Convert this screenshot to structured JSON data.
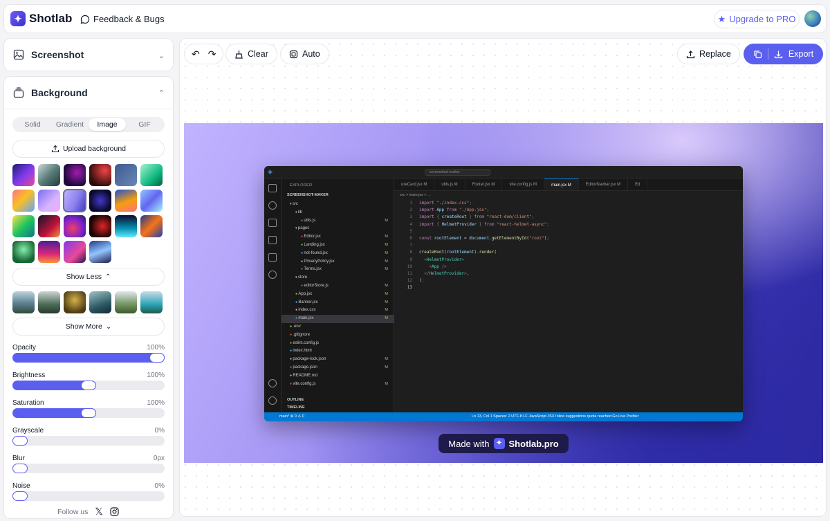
{
  "header": {
    "brand": "Shotlab",
    "feedback_label": "Feedback & Bugs",
    "upgrade_label": "Upgrade to PRO"
  },
  "sidebar": {
    "screenshot_title": "Screenshot",
    "background_title": "Background",
    "bg_tabs": [
      "Solid",
      "Gradient",
      "Image",
      "GIF"
    ],
    "bg_tab_selected": "Image",
    "upload_label": "Upload background",
    "show_less_label": "Show Less",
    "show_more_label": "Show More",
    "sliders": [
      {
        "label": "Opacity",
        "value": "100%",
        "level": 1.0
      },
      {
        "label": "Brightness",
        "value": "100%",
        "level": 0.5
      },
      {
        "label": "Saturation",
        "value": "100%",
        "level": 0.5
      },
      {
        "label": "Grayscale",
        "value": "0%",
        "level": 0.0
      },
      {
        "label": "Blur",
        "value": "0px",
        "level": 0.0
      },
      {
        "label": "Noise",
        "value": "0%",
        "level": 0.0
      }
    ],
    "follow_label": "Follow us"
  },
  "toolbar": {
    "clear_label": "Clear",
    "auto_label": "Auto",
    "replace_label": "Replace",
    "export_label": "Export"
  },
  "editor": {
    "title": "screenshot-maker",
    "explorer_label": "EXPLORER",
    "root": "SCREENSHOT-MAKER",
    "tree": [
      {
        "name": "src",
        "indent": 1,
        "icon": "▾"
      },
      {
        "name": "lib",
        "indent": 2,
        "icon": "▾"
      },
      {
        "name": "utils.js",
        "indent": 3,
        "icon": "",
        "m": true
      },
      {
        "name": "pages",
        "indent": 2,
        "icon": "▾"
      },
      {
        "name": "Editor.jsx",
        "indent": 3,
        "icon": "",
        "m": true
      },
      {
        "name": "Landing.jsx",
        "indent": 3,
        "icon": "",
        "m": true
      },
      {
        "name": "not-found.jsx",
        "indent": 3,
        "icon": "",
        "m": true
      },
      {
        "name": "PrivacyPolicy.jsx",
        "indent": 3,
        "icon": "",
        "m": true
      },
      {
        "name": "Terms.jsx",
        "indent": 3,
        "icon": "",
        "m": true
      },
      {
        "name": "store",
        "indent": 2,
        "icon": "▾"
      },
      {
        "name": "editorStore.js",
        "indent": 3,
        "icon": "",
        "m": true
      },
      {
        "name": "App.jsx",
        "indent": 2,
        "icon": "",
        "m": true
      },
      {
        "name": "Banner.jsx",
        "indent": 2,
        "icon": "",
        "m": true
      },
      {
        "name": "index.css",
        "indent": 2,
        "icon": "",
        "m": true
      },
      {
        "name": "main.jsx",
        "indent": 2,
        "icon": "",
        "m": true,
        "active": true
      },
      {
        "name": ".env",
        "indent": 1,
        "icon": ""
      },
      {
        "name": ".gitignore",
        "indent": 1,
        "icon": ""
      },
      {
        "name": "eslint.config.js",
        "indent": 1,
        "icon": ""
      },
      {
        "name": "index.html",
        "indent": 1,
        "icon": ""
      },
      {
        "name": "package-lock.json",
        "indent": 1,
        "icon": "",
        "m": true
      },
      {
        "name": "package.json",
        "indent": 1,
        "icon": "",
        "m": true
      },
      {
        "name": "README.md",
        "indent": 1,
        "icon": ""
      },
      {
        "name": "vite.config.js",
        "indent": 1,
        "icon": "",
        "m": true
      }
    ],
    "outline_label": "OUTLINE",
    "timeline_label": "TIMELINE",
    "tabs": [
      "ureCard.jsx M",
      "utils.js M",
      "Footer.jsx M",
      "vite.config.js M",
      "main.jsx M",
      "EditorNavbar.jsx M",
      "Ed"
    ],
    "active_tab": "main.jsx M",
    "breadcrumb": "src > main.jsx > ...",
    "status_left": "main*   ⊗ 0 ⚠ 0",
    "status_right": "Ln 13, Col 1   Spaces: 2   UTF-8   LF   JavaScript JSX   Inline suggestions quota reached   Go Live   Prettier"
  },
  "badge": {
    "made_with": "Made with",
    "brand": "Shotlab.pro"
  }
}
